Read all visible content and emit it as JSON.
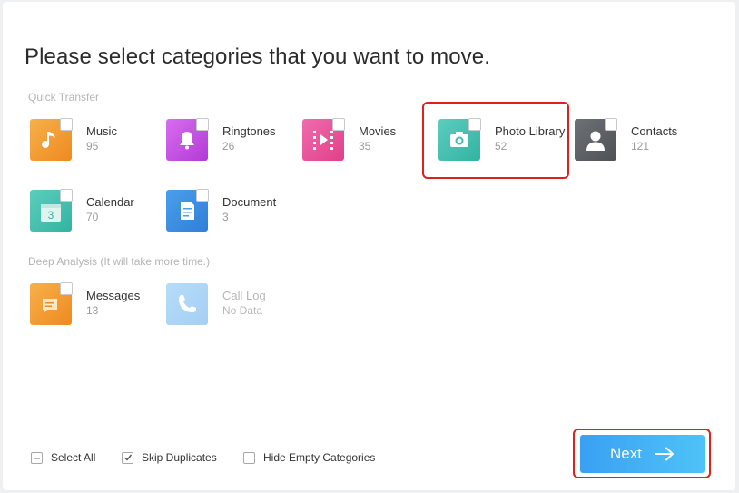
{
  "page": {
    "title": "Please select categories that you want to move."
  },
  "sections": {
    "quick_transfer": "Quick Transfer",
    "deep_analysis": "Deep Analysis (It will take more time.)"
  },
  "quick_transfer_items": [
    {
      "name": "Music",
      "count": "95",
      "icon": "music-note-icon",
      "color": "#f29a2e"
    },
    {
      "name": "Ringtones",
      "count": "26",
      "icon": "bell-icon",
      "color": "#c24fe3"
    },
    {
      "name": "Movies",
      "count": "35",
      "icon": "film-play-icon",
      "color": "#e94f9b"
    },
    {
      "name": "Photo Library",
      "count": "52",
      "icon": "camera-icon",
      "color": "#3fbfae"
    },
    {
      "name": "Contacts",
      "count": "121",
      "icon": "person-silhouette-icon",
      "color": "#5d6064"
    },
    {
      "name": "Calendar",
      "count": "70",
      "icon": "calendar-icon",
      "color": "#3fbfae"
    },
    {
      "name": "Document",
      "count": "3",
      "icon": "document-icon",
      "color": "#3a8fe3"
    }
  ],
  "deep_analysis_items": [
    {
      "name": "Messages",
      "count": "13",
      "icon": "message-icon",
      "color": "#f29a2e"
    },
    {
      "name": "Call Log",
      "count": "No Data",
      "icon": "phone-icon",
      "color": "#4aa6ee"
    }
  ],
  "footer": {
    "select_all": "Select All",
    "skip_duplicates": "Skip Duplicates",
    "hide_empty": "Hide Empty Categories",
    "next": "Next"
  },
  "state": {
    "select_all": "partial",
    "skip_duplicates": true,
    "hide_empty": false
  },
  "colors": {
    "highlight": "#e0201b",
    "next_gradient_start": "#3aa0f3",
    "next_gradient_end": "#4ec3f7"
  }
}
